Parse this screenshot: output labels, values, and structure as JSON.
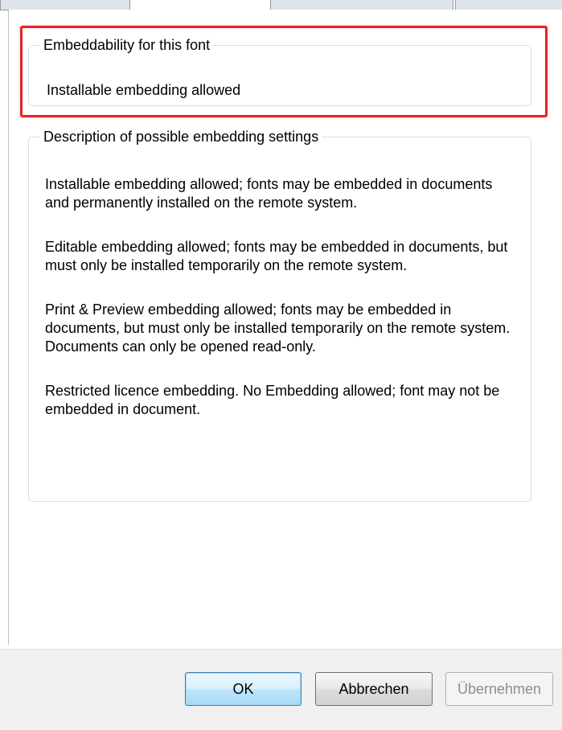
{
  "embeddability": {
    "legend": "Embeddability for this font",
    "value": "Installable embedding allowed"
  },
  "description": {
    "legend": "Description of possible embedding settings",
    "paragraphs": [
      "Installable embedding allowed; fonts may be embedded in documents and permanently installed on the remote system.",
      "Editable embedding allowed; fonts may be embedded in documents, but must only be installed temporarily on the remote system.",
      "Print & Preview embedding allowed; fonts may be embedded in documents, but must only be installed temporarily on the remote system. Documents can only be opened read-only.",
      "Restricted licence embedding. No Embedding allowed; font may not be embedded in document."
    ]
  },
  "buttons": {
    "ok": "OK",
    "cancel": "Abbrechen",
    "apply": "Übernehmen"
  },
  "colors": {
    "highlight": "#e3242b",
    "default_button": "#3c7fb1"
  }
}
